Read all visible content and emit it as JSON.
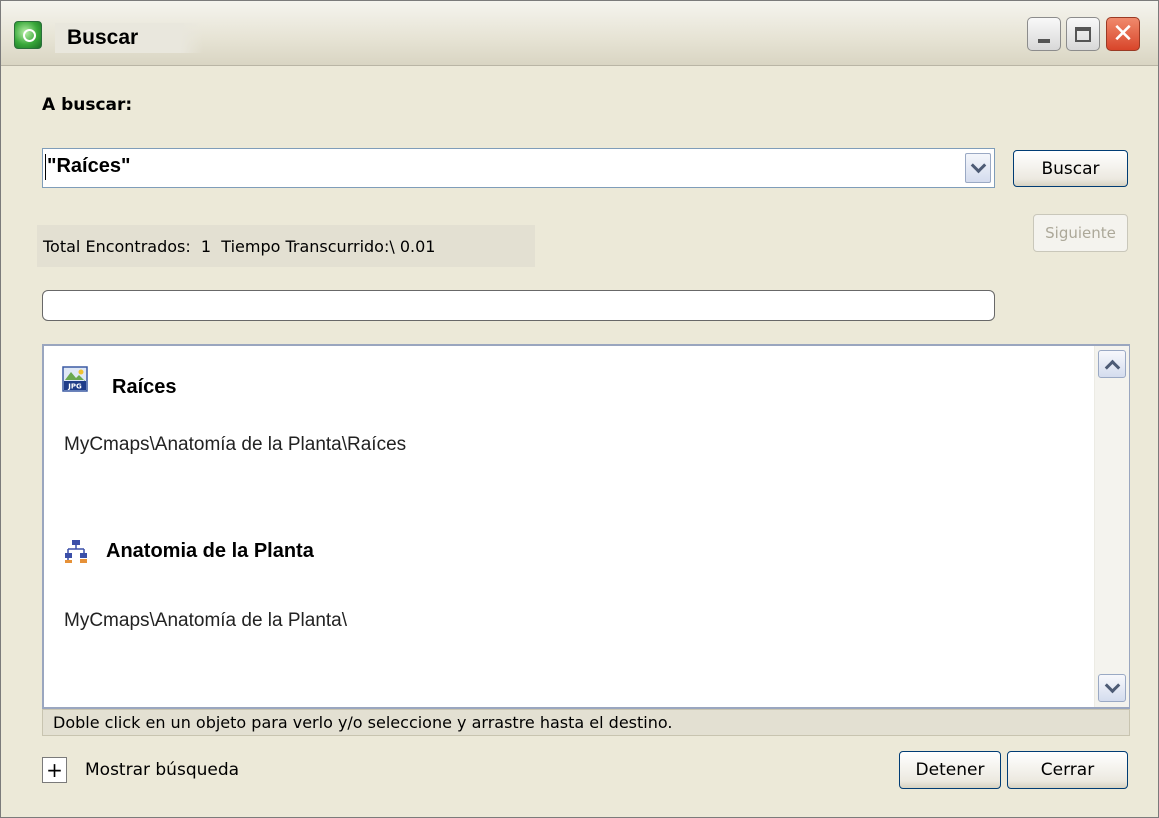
{
  "window": {
    "title": "Buscar",
    "app_icon": "cmaptools-app-icon",
    "controls": [
      "minimize-icon",
      "maximize-icon",
      "close-icon"
    ]
  },
  "search": {
    "label": "A buscar:",
    "query": "\"Raíces\"",
    "button": "Buscar"
  },
  "navigation": {
    "next_label": "Siguiente",
    "next_enabled": false
  },
  "status": {
    "text": "Total Encontrados:  1  Tiempo Transcurrido:\\ 0.01"
  },
  "progress": {
    "value": 0
  },
  "results": [
    {
      "icon": "jpg-file-icon",
      "title": "Raíces",
      "path": "MyCmaps\\Anatomía de la Planta\\Raíces"
    },
    {
      "icon": "concept-map-icon",
      "title": "Anatomia de la Planta",
      "path": "MyCmaps\\Anatomía de la Planta\\"
    }
  ],
  "hint": "Doble click en un objeto para verlo y/o seleccione y arrastre hasta el destino.",
  "footer": {
    "toggle_symbol": "+",
    "toggle_label": "Mostrar búsqueda",
    "stop_button": "Detener",
    "close_button": "Cerrar"
  }
}
